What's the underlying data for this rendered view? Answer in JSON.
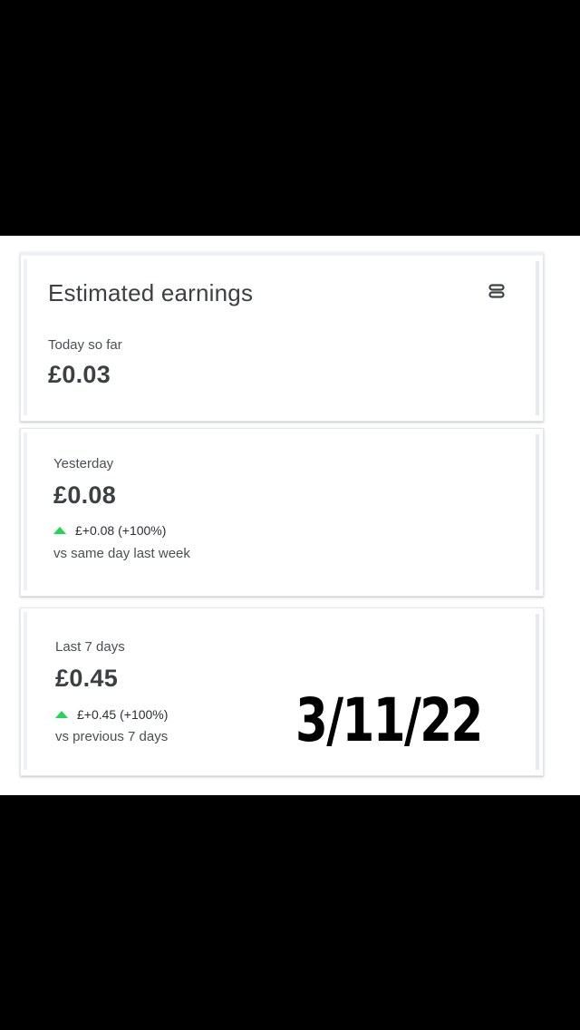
{
  "earnings": {
    "title": "Estimated earnings",
    "menu_icon": "stack-icon",
    "today": {
      "label": "Today so far",
      "value": "£0.03"
    },
    "yesterday": {
      "label": "Yesterday",
      "value": "£0.08",
      "delta": "£+0.08 (+100%)",
      "delta_direction": "up",
      "comparison": "vs same day last week"
    },
    "last7": {
      "label": "Last 7 days",
      "value": "£0.45",
      "delta": "£+0.45 (+100%)",
      "delta_direction": "up",
      "comparison": "vs previous 7 days"
    }
  },
  "overlay": {
    "date_text": "3/11/22"
  },
  "colors": {
    "up_arrow": "#1fd655",
    "text_primary": "#3c4043",
    "letterbox": "#000000"
  }
}
